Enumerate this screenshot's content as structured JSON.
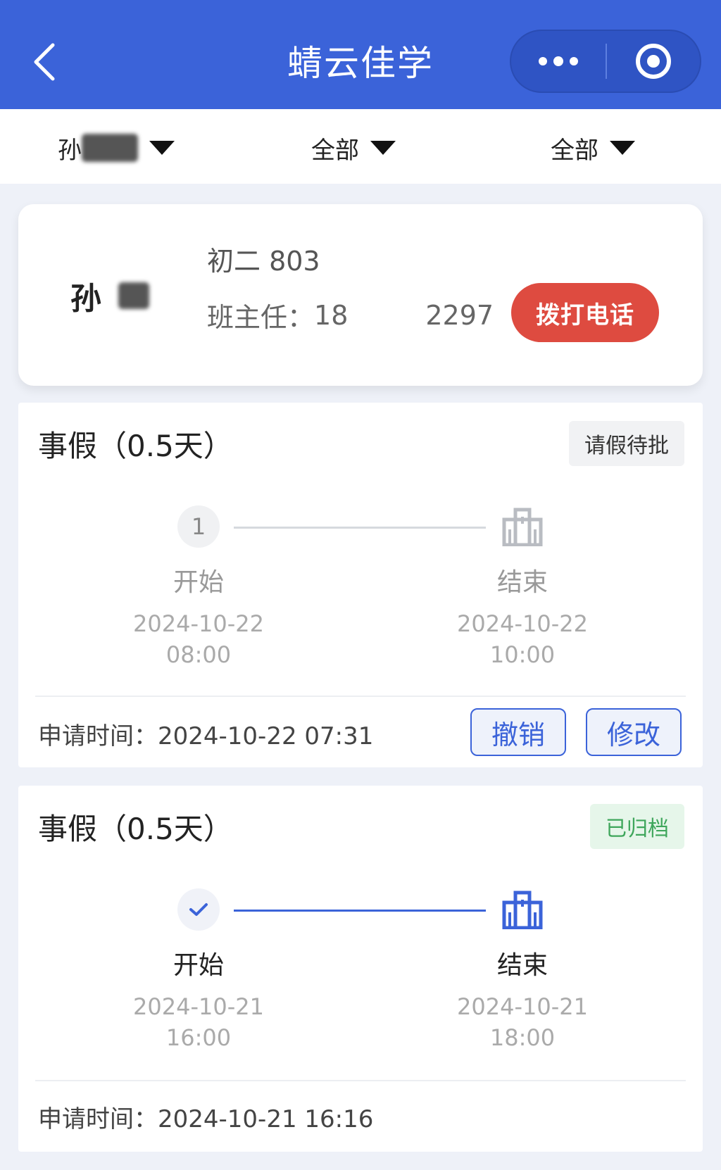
{
  "header": {
    "title": "蜻云佳学",
    "back_icon": "chevron-left-icon",
    "more_icon": "more-dots-icon",
    "target_icon": "target-icon",
    "bg_color": "#3b63d9"
  },
  "filters": {
    "student_partial": "孙",
    "type": "全部",
    "status": "全部"
  },
  "student_card": {
    "name_partial": "孙",
    "class_name": "初二 803",
    "teacher_label": "班主任：",
    "phone_prefix": "18",
    "phone_suffix": "2297",
    "call_button": "拨打电话"
  },
  "leaves": [
    {
      "title": "事假（0.5天）",
      "status": "请假待批",
      "start": {
        "node": "1",
        "label": "开始",
        "date": "2024-10-22",
        "time": "08:00"
      },
      "end": {
        "label": "结束",
        "date": "2024-10-22",
        "time": "10:00"
      },
      "apply_time": "申请时间：2024-10-22 07:31",
      "actions": {
        "cancel": "撤销",
        "modify": "修改"
      }
    },
    {
      "title": "事假（0.5天）",
      "status": "已归档",
      "start": {
        "label": "开始",
        "date": "2024-10-21",
        "time": "16:00"
      },
      "end": {
        "label": "结束",
        "date": "2024-10-21",
        "time": "18:00"
      },
      "apply_time": "申请时间：2024-10-21 16:16"
    }
  ]
}
